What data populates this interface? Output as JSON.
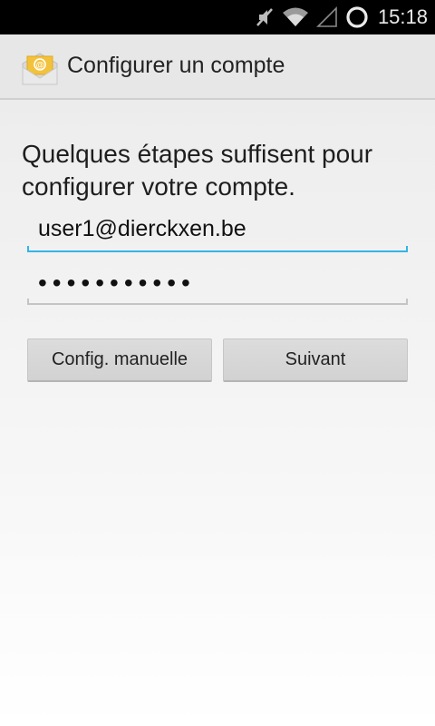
{
  "status_bar": {
    "time": "15:18",
    "icons": [
      "mute-icon",
      "wifi-icon",
      "signal-icon",
      "battery-icon"
    ]
  },
  "action_bar": {
    "title": "Configurer un compte",
    "app_icon": "email-app-icon"
  },
  "main": {
    "instructions": "Quelques étapes suffisent pour configurer votre compte.",
    "email_value": "user1@dierckxen.be",
    "password_value": "•••••••••••",
    "manual_button_label": "Config. manuelle",
    "next_button_label": "Suivant"
  },
  "colors": {
    "accent": "#33b5e5",
    "status_bar": "#000000",
    "action_bar": "#e7e7e7"
  }
}
